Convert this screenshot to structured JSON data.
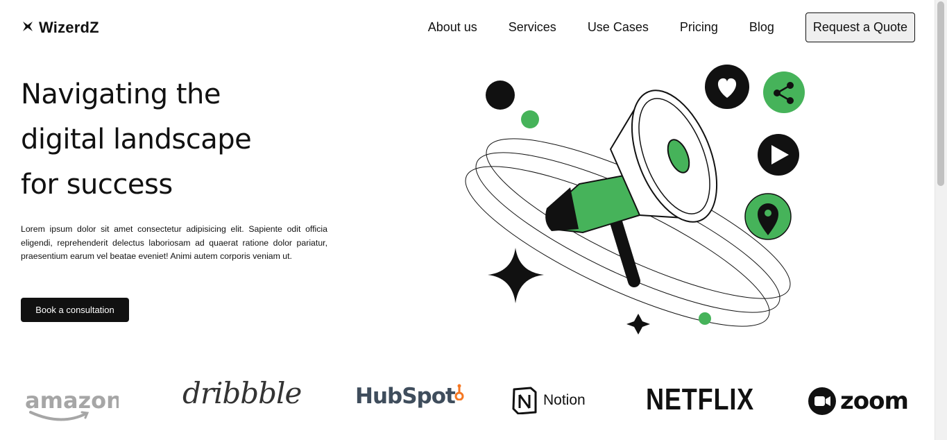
{
  "brand": {
    "name": "WizerdZ",
    "icon": "bowtie-star-icon"
  },
  "nav": {
    "links": [
      "About us",
      "Services",
      "Use Cases",
      "Pricing",
      "Blog"
    ],
    "cta": "Request a Quote"
  },
  "hero": {
    "title_lines": [
      "Navigating the",
      "digital landscape",
      "for success"
    ],
    "description": "Lorem ipsum dolor sit amet consectetur adipisicing elit. Sapiente odit officia eligendi, reprehenderit delectus laboriosam ad quaerat ratione dolor pariatur, praesentium earum vel beatae eveniet! Animi autem corporis veniam ut.",
    "button": "Book a consultation",
    "illustration_icons": [
      "megaphone-icon",
      "heart-icon",
      "share-icon",
      "play-icon",
      "location-pin-icon",
      "four-point-star-icon"
    ]
  },
  "partners": [
    {
      "name": "amazon",
      "icon": "amazon-logo"
    },
    {
      "name": "dribbble",
      "icon": "dribbble-logo"
    },
    {
      "name": "HubSpot",
      "icon": "hubspot-logo"
    },
    {
      "name": "Notion",
      "icon": "notion-logo"
    },
    {
      "name": "NETFLIX",
      "icon": "netflix-logo"
    },
    {
      "name": "zoom",
      "icon": "zoom-logo"
    }
  ],
  "colors": {
    "accent_green": "#46b35a",
    "dark": "#111111",
    "hubspot_orange": "#f57722",
    "amazon_gray": "#a6a6a6"
  }
}
